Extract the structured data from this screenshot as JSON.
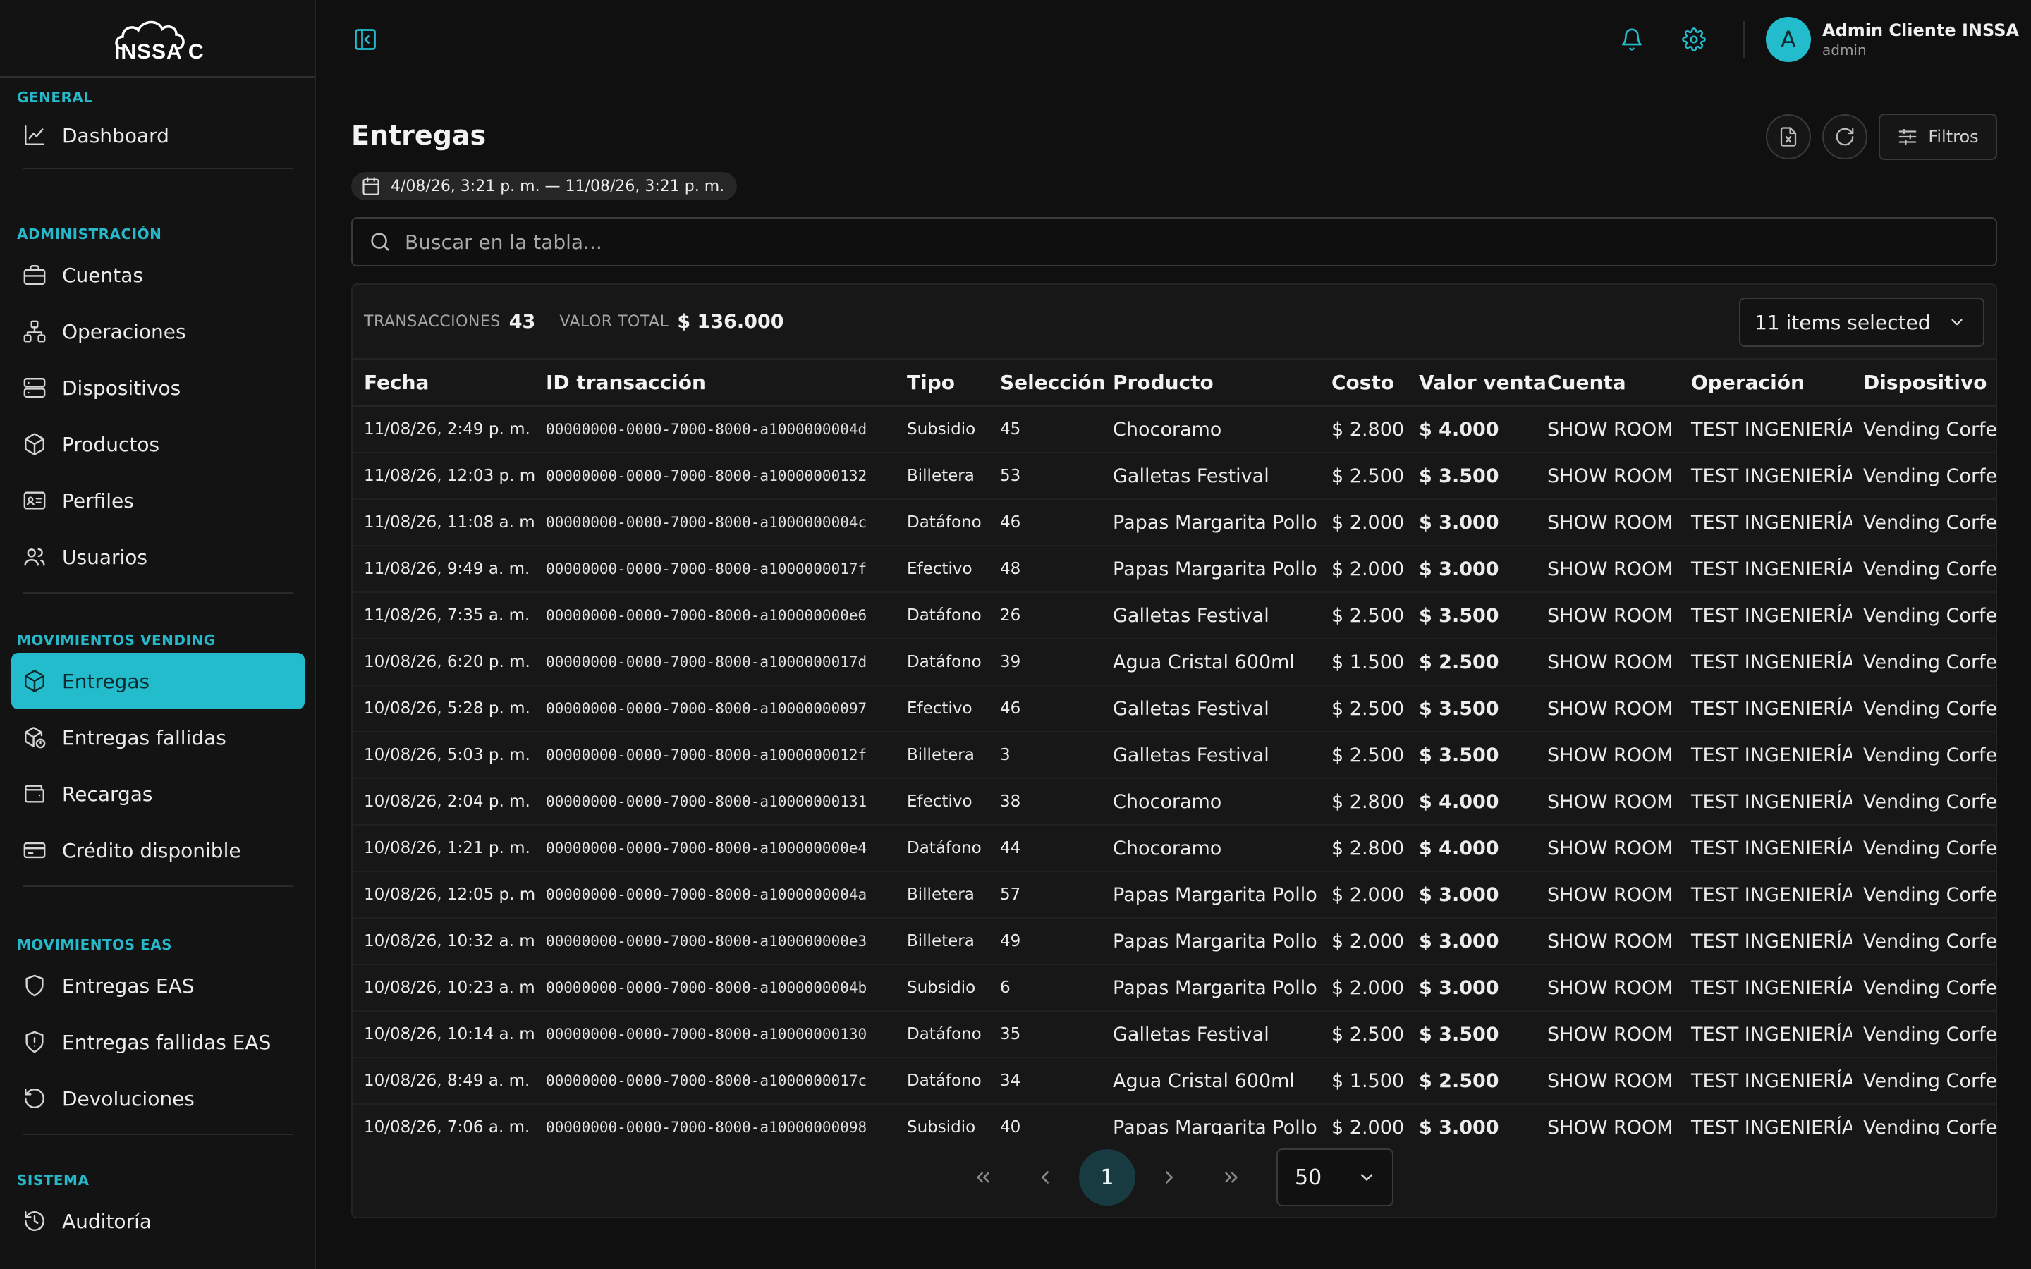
{
  "brand": {
    "logo_text": "INSSA CS",
    "accent": "#22bccd"
  },
  "sidebar": {
    "sections": [
      {
        "title": "GENERAL",
        "items": [
          {
            "label": "Dashboard",
            "icon": "chart-line-icon"
          }
        ]
      },
      {
        "title": "ADMINISTRACIÓN",
        "items": [
          {
            "label": "Cuentas",
            "icon": "briefcase-icon"
          },
          {
            "label": "Operaciones",
            "icon": "network-icon"
          },
          {
            "label": "Dispositivos",
            "icon": "server-icon"
          },
          {
            "label": "Productos",
            "icon": "box-icon"
          },
          {
            "label": "Perfiles",
            "icon": "id-card-icon"
          },
          {
            "label": "Usuarios",
            "icon": "users-icon"
          }
        ]
      },
      {
        "title": "MOVIMIENTOS VENDING",
        "items": [
          {
            "label": "Entregas",
            "icon": "box-icon",
            "active": true
          },
          {
            "label": "Entregas fallidas",
            "icon": "box-alert-icon"
          },
          {
            "label": "Recargas",
            "icon": "wallet-icon"
          },
          {
            "label": "Crédito disponible",
            "icon": "credit-card-icon"
          }
        ]
      },
      {
        "title": "MOVIMIENTOS EAS",
        "items": [
          {
            "label": "Entregas EAS",
            "icon": "shield-icon"
          },
          {
            "label": "Entregas fallidas EAS",
            "icon": "shield-alert-icon"
          },
          {
            "label": "Devoluciones",
            "icon": "undo-icon"
          }
        ]
      },
      {
        "title": "SISTEMA",
        "items": [
          {
            "label": "Auditoría",
            "icon": "history-icon"
          }
        ]
      }
    ]
  },
  "header": {
    "user": {
      "initial": "A",
      "name": "Admin Cliente INSSA",
      "role": "admin"
    }
  },
  "page": {
    "title": "Entregas",
    "date_range": "4/08/26, 3:21 p. m. — 11/08/26, 3:21 p. m.",
    "filters_label": "Filtros",
    "search_placeholder": "Buscar en la tabla..."
  },
  "summary": {
    "transactions_label": "TRANSACCIONES",
    "transactions_value": "43",
    "total_label": "VALOR TOTAL",
    "total_value": "$ 136.000",
    "columns_select": "11 items selected"
  },
  "table": {
    "columns": [
      "Fecha",
      "ID transacción",
      "Tipo",
      "Selección",
      "Producto",
      "Costo",
      "Valor venta",
      "Cuenta",
      "Operación",
      "Dispositivo"
    ],
    "rows": [
      [
        "11/08/26, 2:49 p. m.",
        "00000000-0000-7000-8000-a1000000004d",
        "Subsidio",
        "45",
        "Chocoramo",
        "$ 2.800",
        "$ 4.000",
        "SHOW ROOM",
        "TEST INGENIERÍA",
        "Vending Corfer"
      ],
      [
        "11/08/26, 12:03 p. m.",
        "00000000-0000-7000-8000-a10000000132",
        "Billetera",
        "53",
        "Galletas Festival",
        "$ 2.500",
        "$ 3.500",
        "SHOW ROOM",
        "TEST INGENIERÍA",
        "Vending Corfer"
      ],
      [
        "11/08/26, 11:08 a. m.",
        "00000000-0000-7000-8000-a1000000004c",
        "Datáfono",
        "46",
        "Papas Margarita Pollo",
        "$ 2.000",
        "$ 3.000",
        "SHOW ROOM",
        "TEST INGENIERÍA",
        "Vending Corfer"
      ],
      [
        "11/08/26, 9:49 a. m.",
        "00000000-0000-7000-8000-a1000000017f",
        "Efectivo",
        "48",
        "Papas Margarita Pollo",
        "$ 2.000",
        "$ 3.000",
        "SHOW ROOM",
        "TEST INGENIERÍA",
        "Vending Corfer"
      ],
      [
        "11/08/26, 7:35 a. m.",
        "00000000-0000-7000-8000-a100000000e6",
        "Datáfono",
        "26",
        "Galletas Festival",
        "$ 2.500",
        "$ 3.500",
        "SHOW ROOM",
        "TEST INGENIERÍA",
        "Vending Corfer"
      ],
      [
        "10/08/26, 6:20 p. m.",
        "00000000-0000-7000-8000-a1000000017d",
        "Datáfono",
        "39",
        "Agua Cristal 600ml",
        "$ 1.500",
        "$ 2.500",
        "SHOW ROOM",
        "TEST INGENIERÍA",
        "Vending Corfer"
      ],
      [
        "10/08/26, 5:28 p. m.",
        "00000000-0000-7000-8000-a10000000097",
        "Efectivo",
        "46",
        "Galletas Festival",
        "$ 2.500",
        "$ 3.500",
        "SHOW ROOM",
        "TEST INGENIERÍA",
        "Vending Corfer"
      ],
      [
        "10/08/26, 5:03 p. m.",
        "00000000-0000-7000-8000-a1000000012f",
        "Billetera",
        "3",
        "Galletas Festival",
        "$ 2.500",
        "$ 3.500",
        "SHOW ROOM",
        "TEST INGENIERÍA",
        "Vending Corfer"
      ],
      [
        "10/08/26, 2:04 p. m.",
        "00000000-0000-7000-8000-a10000000131",
        "Efectivo",
        "38",
        "Chocoramo",
        "$ 2.800",
        "$ 4.000",
        "SHOW ROOM",
        "TEST INGENIERÍA",
        "Vending Corfer"
      ],
      [
        "10/08/26, 1:21 p. m.",
        "00000000-0000-7000-8000-a100000000e4",
        "Datáfono",
        "44",
        "Chocoramo",
        "$ 2.800",
        "$ 4.000",
        "SHOW ROOM",
        "TEST INGENIERÍA",
        "Vending Corfer"
      ],
      [
        "10/08/26, 12:05 p. m.",
        "00000000-0000-7000-8000-a1000000004a",
        "Billetera",
        "57",
        "Papas Margarita Pollo",
        "$ 2.000",
        "$ 3.000",
        "SHOW ROOM",
        "TEST INGENIERÍA",
        "Vending Corfer"
      ],
      [
        "10/08/26, 10:32 a. m.",
        "00000000-0000-7000-8000-a100000000e3",
        "Billetera",
        "49",
        "Papas Margarita Pollo",
        "$ 2.000",
        "$ 3.000",
        "SHOW ROOM",
        "TEST INGENIERÍA",
        "Vending Corfer"
      ],
      [
        "10/08/26, 10:23 a. m.",
        "00000000-0000-7000-8000-a1000000004b",
        "Subsidio",
        "6",
        "Papas Margarita Pollo",
        "$ 2.000",
        "$ 3.000",
        "SHOW ROOM",
        "TEST INGENIERÍA",
        "Vending Corfer"
      ],
      [
        "10/08/26, 10:14 a. m.",
        "00000000-0000-7000-8000-a10000000130",
        "Datáfono",
        "35",
        "Galletas Festival",
        "$ 2.500",
        "$ 3.500",
        "SHOW ROOM",
        "TEST INGENIERÍA",
        "Vending Corfer"
      ],
      [
        "10/08/26, 8:49 a. m.",
        "00000000-0000-7000-8000-a1000000017c",
        "Datáfono",
        "34",
        "Agua Cristal 600ml",
        "$ 1.500",
        "$ 2.500",
        "SHOW ROOM",
        "TEST INGENIERÍA",
        "Vending Corfer"
      ],
      [
        "10/08/26, 7:06 a. m.",
        "00000000-0000-7000-8000-a10000000098",
        "Subsidio",
        "40",
        "Papas Margarita Pollo",
        "$ 2.000",
        "$ 3.000",
        "SHOW ROOM",
        "TEST INGENIERÍA",
        "Vending Corfer"
      ]
    ]
  },
  "pagination": {
    "current_page": "1",
    "page_size": "50"
  }
}
